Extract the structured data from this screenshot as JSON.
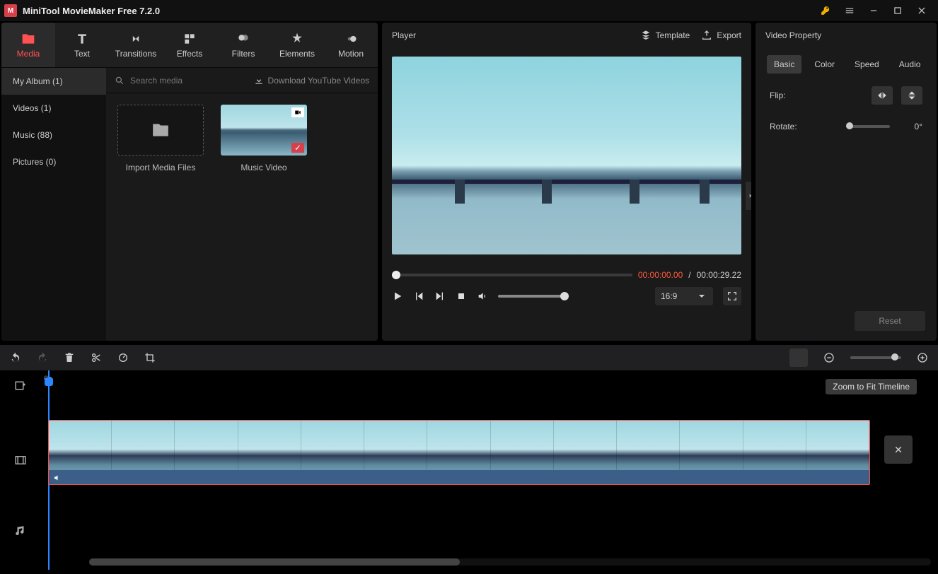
{
  "app": {
    "title": "MiniTool MovieMaker Free 7.2.0"
  },
  "toptabs": [
    {
      "label": "Media",
      "active": true
    },
    {
      "label": "Text"
    },
    {
      "label": "Transitions"
    },
    {
      "label": "Effects"
    },
    {
      "label": "Filters"
    },
    {
      "label": "Elements"
    },
    {
      "label": "Motion"
    }
  ],
  "media": {
    "side": [
      {
        "label": "My Album (1)",
        "active": true
      },
      {
        "label": "Videos (1)"
      },
      {
        "label": "Music (88)"
      },
      {
        "label": "Pictures (0)"
      }
    ],
    "search_placeholder": "Search media",
    "download_label": "Download YouTube Videos",
    "import_label": "Import Media Files",
    "clip_label": "Music Video"
  },
  "player": {
    "title": "Player",
    "template_label": "Template",
    "export_label": "Export",
    "current_time": "00:00:00.00",
    "separator": " / ",
    "total_time": "00:00:29.22",
    "ratio": "16:9"
  },
  "property": {
    "title": "Video Property",
    "tabs": [
      {
        "label": "Basic",
        "active": true
      },
      {
        "label": "Color"
      },
      {
        "label": "Speed"
      },
      {
        "label": "Audio"
      }
    ],
    "flip_label": "Flip:",
    "rotate_label": "Rotate:",
    "rotate_value": "0°",
    "reset_label": "Reset"
  },
  "timeline": {
    "ruler_zero": "0s",
    "tooltip": "Zoom to Fit Timeline"
  }
}
